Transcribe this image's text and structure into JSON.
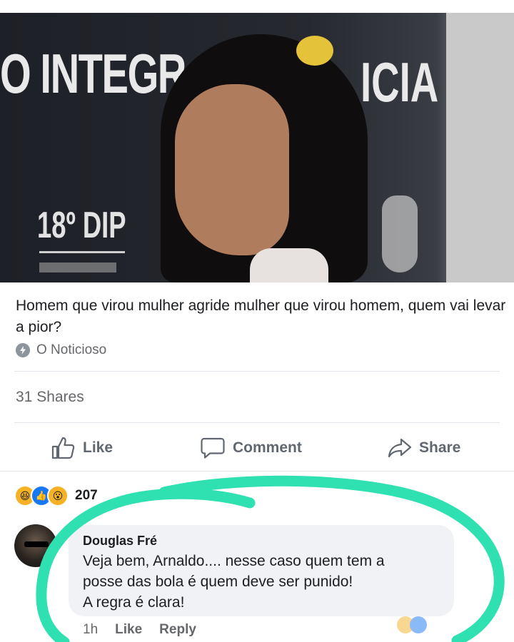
{
  "post": {
    "image": {
      "sign_top": "O INTEGR",
      "sign_right": "ICIA",
      "sign_dip": "18º DIP"
    },
    "caption": "Homem que virou mulher agride mulher que virou homem, quem vai levar a pior?",
    "source": {
      "icon": "lightning-icon",
      "name": "O Noticioso"
    },
    "shares": "31 Shares",
    "actions": {
      "like": "Like",
      "comment": "Comment",
      "share": "Share"
    }
  },
  "reactions": {
    "icons": [
      "haha",
      "like",
      "wow"
    ],
    "count": "207"
  },
  "comment": {
    "author": "Douglas Fré",
    "text": "Veja bem, Arnaldo.... nesse caso quem tem a\nposse das bola é quem deve ser punido!\nA regra é clara!",
    "time": "1h",
    "like_label": "Like",
    "reply_label": "Reply"
  },
  "colors": {
    "highlight_stroke": "#2fe0b0",
    "facebook_blue": "#1877f2",
    "muted_text": "#65676b"
  }
}
